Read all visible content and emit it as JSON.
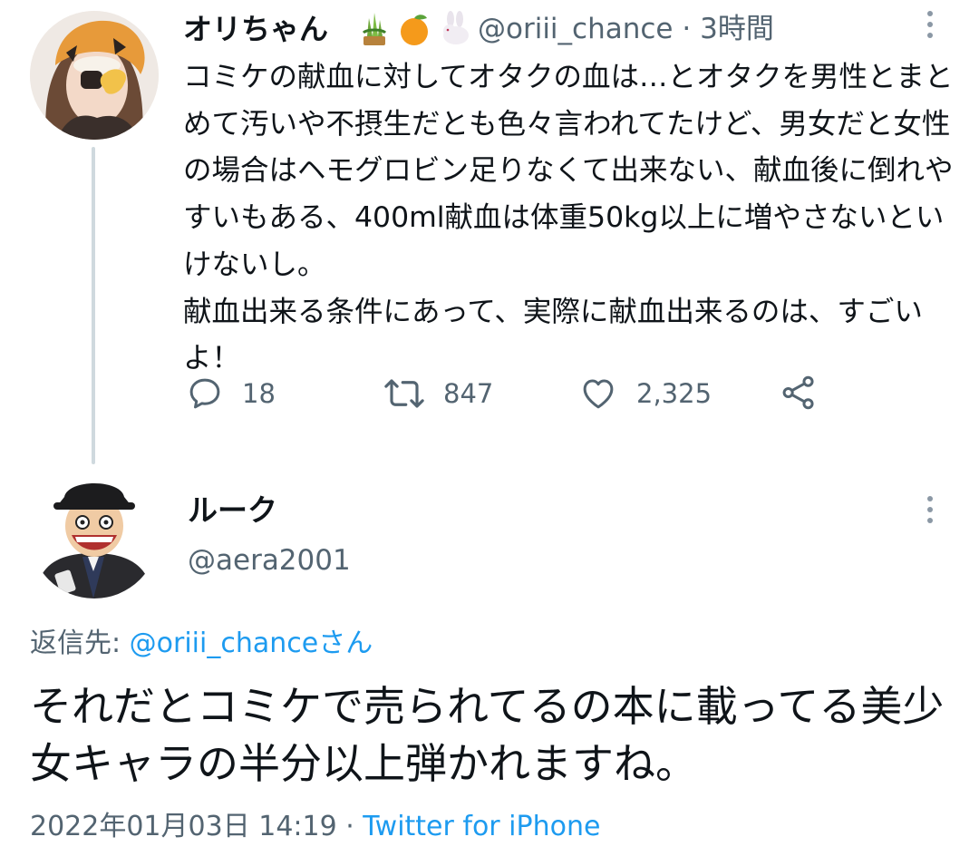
{
  "tweet1": {
    "display_name": "オリちゃん",
    "name_emojis": [
      "kadomatsu-icon",
      "tangerine-icon",
      "rabbit-icon"
    ],
    "handle": "@oriii_chance",
    "separator": "·",
    "time": "3時間",
    "text": "コミケの献血に対してオタクの血は…とオタクを男性とまとめて汚いや不摂生だとも色々言われてたけど、男女だと女性の場合はヘモグロビン足りなくて出来ない、献血後に倒れやすいもある、400ml献血は体重50kg以上に増やさないといけないし。\n献血出来る条件にあって、実際に献血出来るのは、すごいよ！",
    "replies": "18",
    "retweets": "847",
    "likes": "2,325"
  },
  "tweet2": {
    "display_name": "ルーク",
    "handle": "@aera2001",
    "reply_label": "返信先: ",
    "reply_to": "@oriii_chanceさん",
    "text": "それだとコミケで売られてるの本に載ってる美少女キャラの半分以上弾かれますね。",
    "timestamp": "2022年01月03日 14:19",
    "separator": " · ",
    "source": "Twitter for iPhone"
  },
  "colors": {
    "text": "#0f1419",
    "secondary": "#536471",
    "link": "#1d9bf0",
    "thread_line": "#cfd9de"
  }
}
